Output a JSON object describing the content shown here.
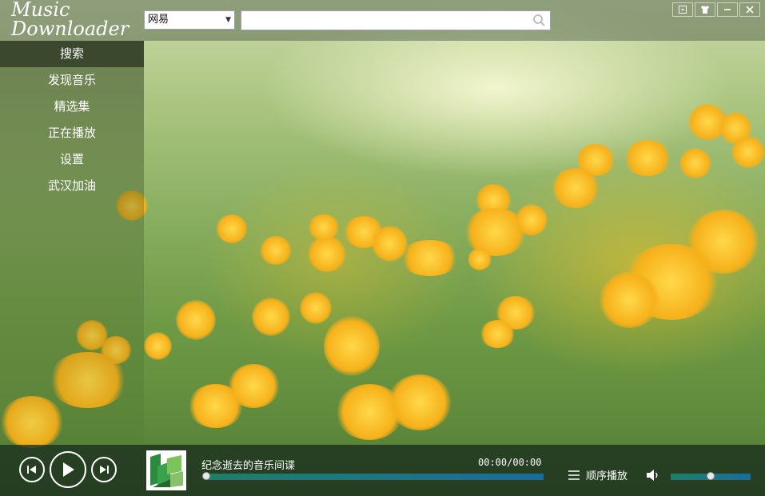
{
  "app": {
    "logo_line1": "Music",
    "logo_line2": "Downloader"
  },
  "toolbar": {
    "source_selected": "网易",
    "search_value": "",
    "window_buttons": [
      "skin-menu-icon",
      "shirt-icon",
      "minimize-icon",
      "close-icon"
    ]
  },
  "sidebar": {
    "items": [
      {
        "label": "搜索",
        "active": true
      },
      {
        "label": "发现音乐"
      },
      {
        "label": "精选集"
      },
      {
        "label": "正在播放"
      },
      {
        "label": "设置"
      },
      {
        "label": "武汉加油"
      }
    ]
  },
  "player": {
    "song_title": "纪念逝去的音乐间谍",
    "time": "00:00/00:00",
    "progress": 0,
    "play_mode": "顺序播放",
    "volume": 0.5,
    "controls": [
      "previous-icon",
      "play-icon",
      "next-icon"
    ]
  },
  "colors": {
    "progress_fill": "#1f7f68",
    "player_bg": "#192d1e"
  }
}
